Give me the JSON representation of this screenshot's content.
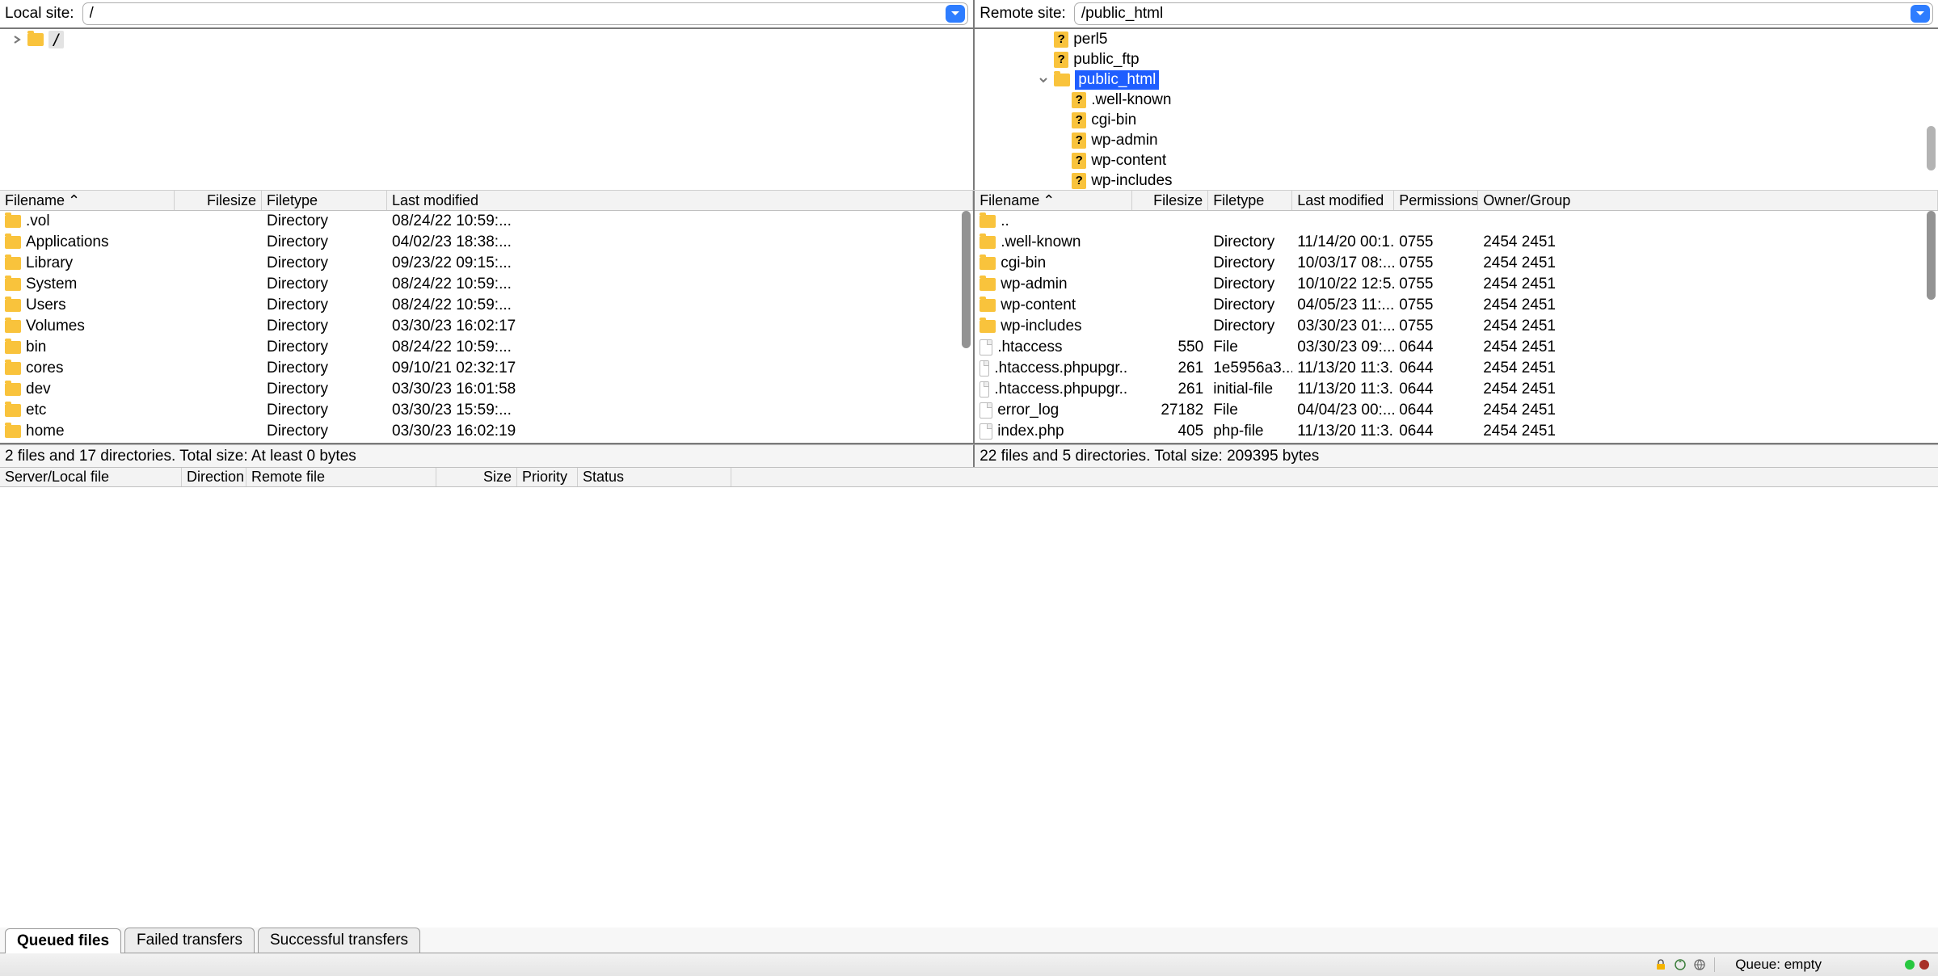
{
  "local": {
    "label": "Local site:",
    "path": "/",
    "tree": {
      "root": "/"
    },
    "columns": {
      "filename": "Filename",
      "filesize": "Filesize",
      "filetype": "Filetype",
      "modified": "Last modified"
    },
    "rows": [
      {
        "name": ".vol",
        "type": "Directory",
        "modified": "08/24/22 10:59:..."
      },
      {
        "name": "Applications",
        "type": "Directory",
        "modified": "04/02/23 18:38:..."
      },
      {
        "name": "Library",
        "type": "Directory",
        "modified": "09/23/22 09:15:..."
      },
      {
        "name": "System",
        "type": "Directory",
        "modified": "08/24/22 10:59:..."
      },
      {
        "name": "Users",
        "type": "Directory",
        "modified": "08/24/22 10:59:..."
      },
      {
        "name": "Volumes",
        "type": "Directory",
        "modified": "03/30/23 16:02:17"
      },
      {
        "name": "bin",
        "type": "Directory",
        "modified": "08/24/22 10:59:..."
      },
      {
        "name": "cores",
        "type": "Directory",
        "modified": "09/10/21 02:32:17"
      },
      {
        "name": "dev",
        "type": "Directory",
        "modified": "03/30/23 16:01:58"
      },
      {
        "name": "etc",
        "type": "Directory",
        "modified": "03/30/23 15:59:..."
      },
      {
        "name": "home",
        "type": "Directory",
        "modified": "03/30/23 16:02:19"
      }
    ],
    "status": "2 files and 17 directories. Total size: At least 0 bytes"
  },
  "remote": {
    "label": "Remote site:",
    "path": "/public_html",
    "tree": {
      "items": [
        {
          "name": "perl5",
          "indent": 3,
          "icon": "unknown"
        },
        {
          "name": "public_ftp",
          "indent": 3,
          "icon": "unknown"
        },
        {
          "name": "public_html",
          "indent": 3,
          "icon": "folder",
          "expanded": true,
          "selected": true
        },
        {
          "name": ".well-known",
          "indent": 4,
          "icon": "unknown"
        },
        {
          "name": "cgi-bin",
          "indent": 4,
          "icon": "unknown"
        },
        {
          "name": "wp-admin",
          "indent": 4,
          "icon": "unknown"
        },
        {
          "name": "wp-content",
          "indent": 4,
          "icon": "unknown"
        },
        {
          "name": "wp-includes",
          "indent": 4,
          "icon": "unknown"
        }
      ]
    },
    "columns": {
      "filename": "Filename",
      "filesize": "Filesize",
      "filetype": "Filetype",
      "modified": "Last modified",
      "permissions": "Permissions",
      "owner": "Owner/Group"
    },
    "rows": [
      {
        "name": "..",
        "icon": "folder"
      },
      {
        "name": ".well-known",
        "icon": "folder",
        "type": "Directory",
        "modified": "11/14/20 00:1...",
        "perm": "0755",
        "owner": "2454 2451"
      },
      {
        "name": "cgi-bin",
        "icon": "folder",
        "type": "Directory",
        "modified": "10/03/17 08:...",
        "perm": "0755",
        "owner": "2454 2451"
      },
      {
        "name": "wp-admin",
        "icon": "folder",
        "type": "Directory",
        "modified": "10/10/22 12:5...",
        "perm": "0755",
        "owner": "2454 2451"
      },
      {
        "name": "wp-content",
        "icon": "folder",
        "type": "Directory",
        "modified": "04/05/23 11:...",
        "perm": "0755",
        "owner": "2454 2451"
      },
      {
        "name": "wp-includes",
        "icon": "folder",
        "type": "Directory",
        "modified": "03/30/23 01:...",
        "perm": "0755",
        "owner": "2454 2451"
      },
      {
        "name": ".htaccess",
        "icon": "file",
        "size": "550",
        "type": "File",
        "modified": "03/30/23 09:...",
        "perm": "0644",
        "owner": "2454 2451"
      },
      {
        "name": ".htaccess.phpupgr..",
        "icon": "file",
        "size": "261",
        "type": "1e5956a3...",
        "modified": "11/13/20 11:3...",
        "perm": "0644",
        "owner": "2454 2451"
      },
      {
        "name": ".htaccess.phpupgr..",
        "icon": "file",
        "size": "261",
        "type": "initial-file",
        "modified": "11/13/20 11:3...",
        "perm": "0644",
        "owner": "2454 2451"
      },
      {
        "name": "error_log",
        "icon": "file",
        "size": "27182",
        "type": "File",
        "modified": "04/04/23 00:...",
        "perm": "0644",
        "owner": "2454 2451"
      },
      {
        "name": "index.php",
        "icon": "file",
        "size": "405",
        "type": "php-file",
        "modified": "11/13/20 11:3...",
        "perm": "0644",
        "owner": "2454 2451"
      }
    ],
    "status": "22 files and 5 directories. Total size: 209395 bytes"
  },
  "queue": {
    "columns": {
      "server": "Server/Local file",
      "direction": "Direction",
      "remote": "Remote file",
      "size": "Size",
      "priority": "Priority",
      "status": "Status"
    }
  },
  "tabs": {
    "queued": "Queued files",
    "failed": "Failed transfers",
    "successful": "Successful transfers"
  },
  "statusbar": {
    "queue": "Queue: empty"
  }
}
